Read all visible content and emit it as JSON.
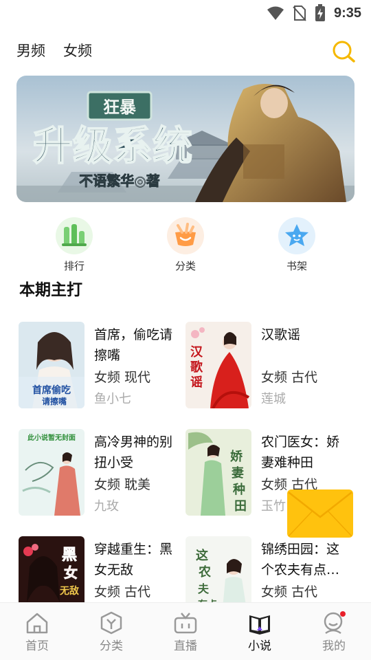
{
  "status_bar": {
    "time": "9:35",
    "icons": [
      "wifi-icon",
      "no-sim-icon",
      "battery-charging-icon"
    ]
  },
  "top_tabs": [
    {
      "label": "男频"
    },
    {
      "label": "女频"
    }
  ],
  "search": {
    "icon": "search-icon",
    "color": "#f5b800"
  },
  "banner": {
    "badge": "狂暴",
    "title": "升级系统",
    "author_line": "不语繁华◎著"
  },
  "quick_entries": [
    {
      "label": "排行",
      "icon": "ranking-icon",
      "color": "#7ed37a",
      "bg": "#e9f8e6"
    },
    {
      "label": "分类",
      "icon": "category-icon",
      "color": "#ff9b45",
      "bg": "#fdeee2"
    },
    {
      "label": "书架",
      "icon": "bookshelf-icon",
      "color": "#4aa8f0",
      "bg": "#e3f1fc"
    }
  ],
  "section": {
    "title": "本期主打"
  },
  "books": [
    {
      "title": "首席，偷吃请擦嘴",
      "meta": "女频 现代",
      "author": "鱼小七",
      "cover_text": "首席偷吃请擦嘴"
    },
    {
      "title": "汉歌谣",
      "meta": "女频 古代",
      "author": "莲城",
      "cover_text": "汉歌谣"
    },
    {
      "title": "高冷男神的别扭小受",
      "meta": "女频 耽美",
      "author": "九玫",
      "cover_text": "此小说暂无封面"
    },
    {
      "title": "农门医女：娇妻难种田",
      "meta": "女频 古代",
      "author": "玉竹",
      "cover_text": "娇妻难种田"
    },
    {
      "title": "穿越重生：黑女无敌",
      "meta": "女频 古代",
      "author": "",
      "cover_text": "黑女无敌"
    },
    {
      "title": "锦绣田园：这个农夫有点…",
      "meta": "女频 古代",
      "author": "",
      "cover_text": "这个农夫有点"
    }
  ],
  "floating": {
    "icon": "envelope-icon",
    "color": "#ffc20e"
  },
  "bottom_nav": [
    {
      "label": "首页",
      "icon": "home-icon"
    },
    {
      "label": "分类",
      "icon": "category-nav-icon"
    },
    {
      "label": "直播",
      "icon": "live-tv-icon"
    },
    {
      "label": "小说",
      "icon": "book-open-icon",
      "active": true
    },
    {
      "label": "我的",
      "icon": "profile-icon",
      "has_dot": true
    }
  ]
}
